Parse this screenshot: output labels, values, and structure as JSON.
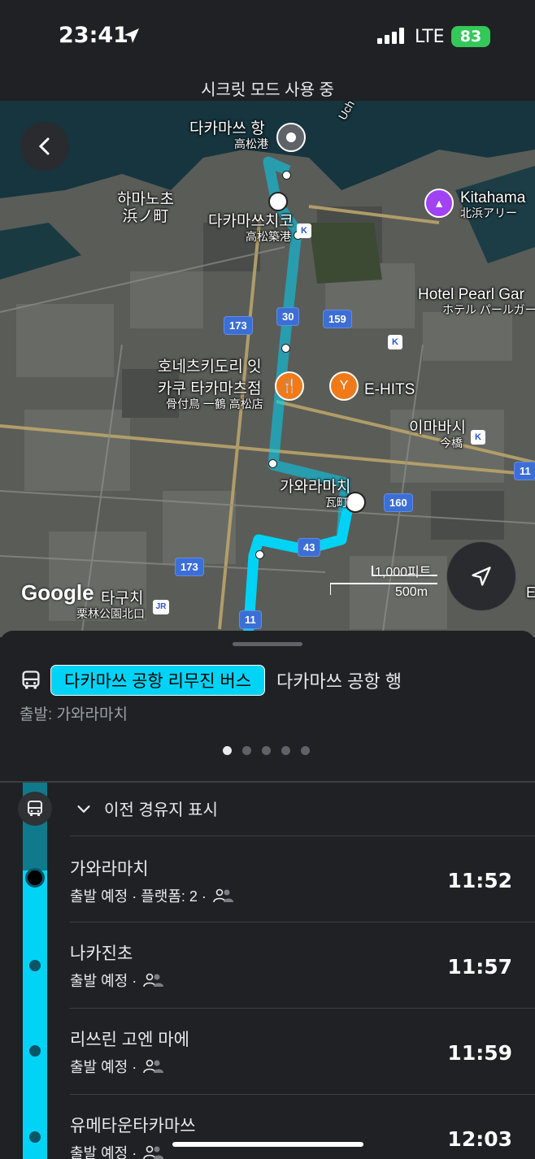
{
  "status": {
    "time": "23:41",
    "network": "LTE",
    "battery": "83"
  },
  "banner": {
    "incognito": "시크릿 모드 사용 중"
  },
  "map": {
    "labels": [
      {
        "main": "다카마쓰 항",
        "sub": "高松港"
      },
      {
        "main": "하마노초",
        "sub": "浜ノ町"
      },
      {
        "main": "다카마쓰치코",
        "sub": "高松築港"
      },
      {
        "main": "Kitahama",
        "sub": "北浜アリー"
      },
      {
        "main": "Hotel Pearl Gar",
        "sub": "ホテル パールガー"
      },
      {
        "main": "호네츠키도리 잇",
        "sub": ""
      },
      {
        "main": "카쿠 타카마츠점",
        "sub": "骨付鳥 一鶴 高松店"
      },
      {
        "main": "E-HITS",
        "sub": ""
      },
      {
        "main": "이마바시",
        "sub": "今橋"
      },
      {
        "main": "가와라마치",
        "sub": "瓦町"
      },
      {
        "main": "타구치",
        "sub": "栗林公園北口"
      }
    ],
    "road_badges": [
      "173",
      "30",
      "159",
      "173",
      "160",
      "43",
      "11",
      "11"
    ],
    "water_label": "Uch",
    "google": "Google",
    "scale_ft": "1,000피트",
    "scale_m": "500m",
    "edge_letter": "E"
  },
  "sheet": {
    "route_name": "다카마쓰 공항 리무진 버스",
    "headsign": "다카마쓰 공항 행",
    "departure": "출발: 가와라마치",
    "show_previous": "이전 경유지 표시",
    "stops": [
      {
        "name": "가와라마치",
        "sub": "출발 예정 · 플랫폼: 2 ·",
        "time": "11:52"
      },
      {
        "name": "나카진초",
        "sub": "출발 예정 ·",
        "time": "11:57"
      },
      {
        "name": "리쓰린 고엔 마에",
        "sub": "출발 예정 ·",
        "time": "11:59"
      },
      {
        "name": "유메타운타카마쓰",
        "sub": "출발 예정 ·",
        "time": "12:03"
      }
    ]
  },
  "colors": {
    "route": "#00d3f5",
    "background": "#202124",
    "battery": "#34c759"
  }
}
